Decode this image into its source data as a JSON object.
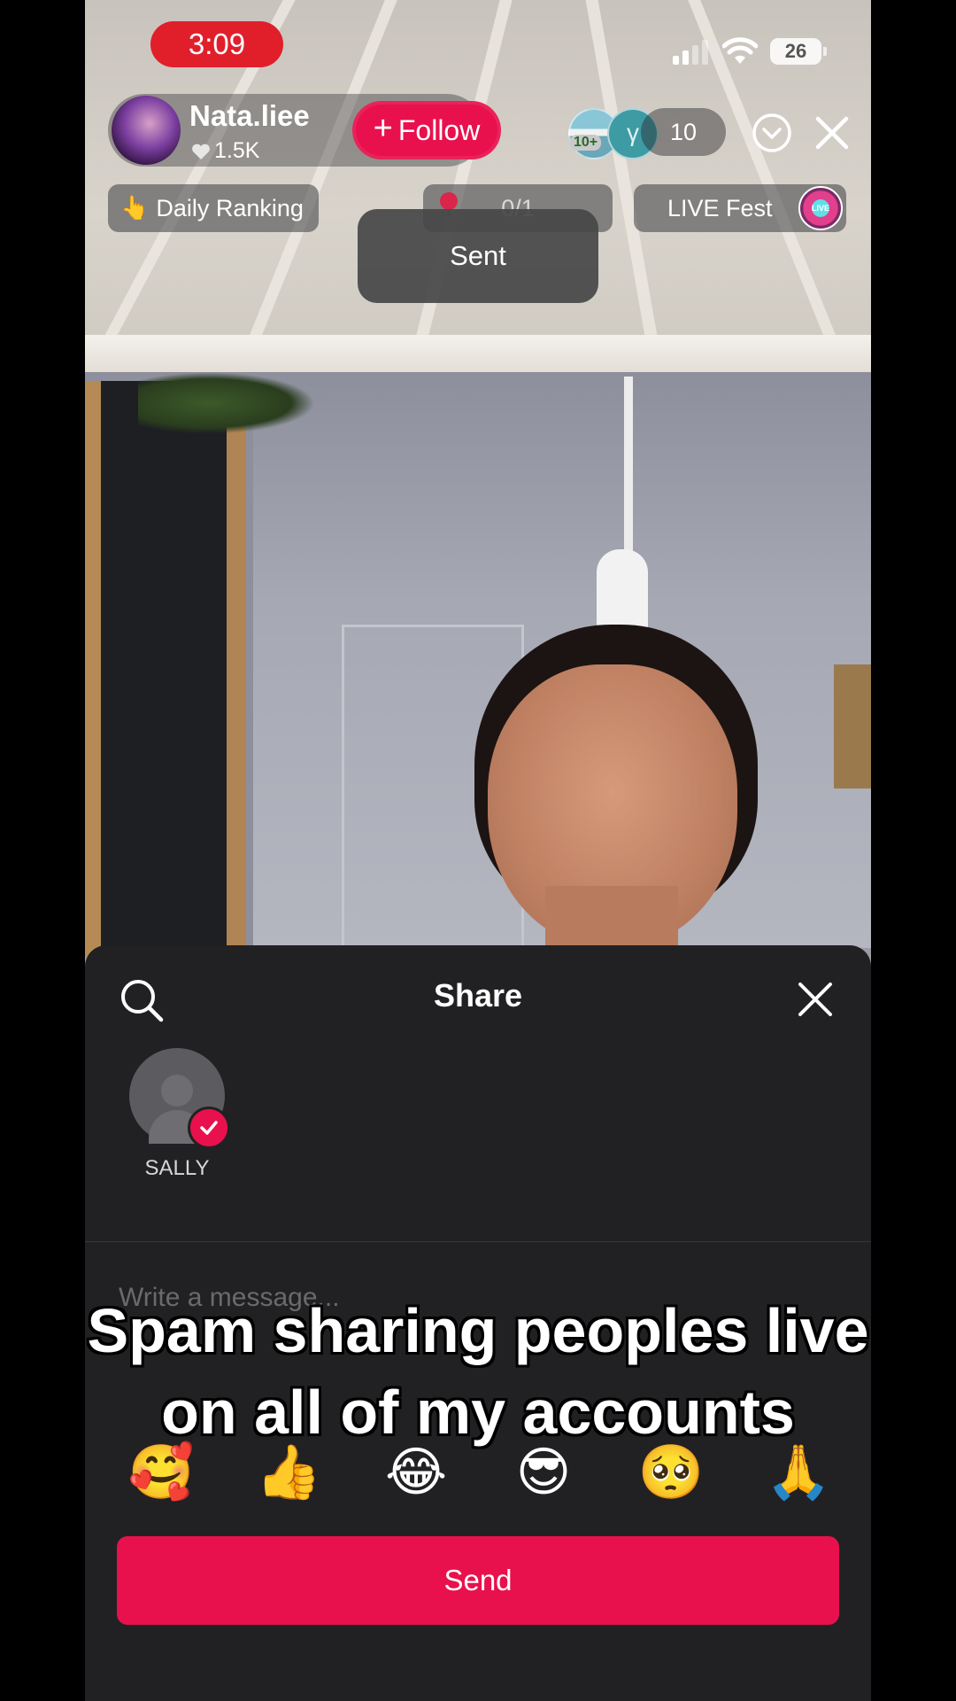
{
  "status_bar": {
    "time": "3:09",
    "battery": "26"
  },
  "host": {
    "name": "Nata.liee",
    "likes": "1.5K",
    "follow_label": "Follow"
  },
  "viewers": {
    "badge": "10+",
    "avatar2_letter": "γ",
    "count": "10"
  },
  "chips": {
    "ranking_label": "Daily Ranking",
    "gift_progress": "0/1",
    "fest_label": "LIVE Fest",
    "fest_badge": "LIVE"
  },
  "toast": "Sent",
  "share_sheet": {
    "title": "Share",
    "contacts": [
      {
        "name": "SALLY",
        "selected": true
      }
    ],
    "message_placeholder": "Write a message...",
    "emojis": [
      "🥰",
      "👍",
      "😂",
      "😎",
      "🥺",
      "🙏"
    ],
    "send_label": "Send"
  },
  "caption": {
    "line1": "Spam sharing peoples live",
    "line2": "on all of my accounts"
  },
  "colors": {
    "accent": "#e8114d",
    "time_pill": "#e01f2b",
    "sheet_bg": "#212123"
  }
}
